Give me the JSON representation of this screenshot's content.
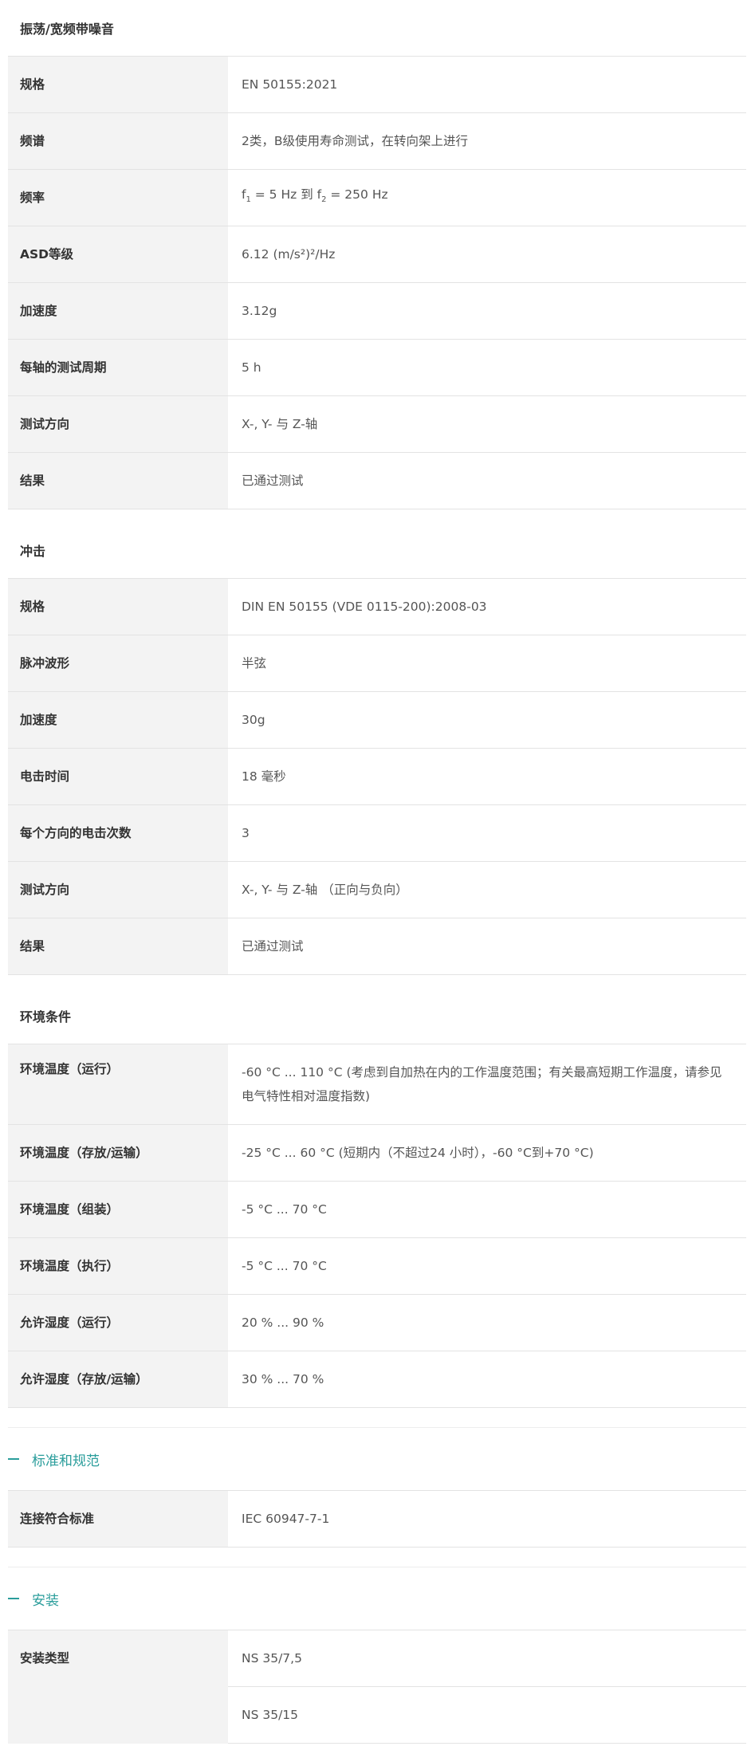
{
  "vibration": {
    "title": "振荡/宽频带噪音",
    "rows": [
      {
        "label": "规格",
        "value": "EN 50155:2021"
      },
      {
        "label": "频谱",
        "value": "2类，B级使用寿命测试，在转向架上进行"
      },
      {
        "label": "频率",
        "f1_prefix": "f",
        "f1_sub": "1",
        "f1_value": " = 5 Hz 到 ",
        "f2_prefix": "f",
        "f2_sub": "2",
        "f2_value": " = 250 Hz"
      },
      {
        "label": "ASD等级",
        "value": "6.12 (m/s²)²/Hz"
      },
      {
        "label": "加速度",
        "value": "3.12g"
      },
      {
        "label": "每轴的测试周期",
        "value": "5 h"
      },
      {
        "label": "测试方向",
        "value": "X-, Y- 与 Z-轴"
      },
      {
        "label": "结果",
        "value": "已通过测试"
      }
    ]
  },
  "shock": {
    "title": "冲击",
    "rows": [
      {
        "label": "规格",
        "value": "DIN EN 50155 (VDE 0115-200):2008-03"
      },
      {
        "label": "脉冲波形",
        "value": "半弦"
      },
      {
        "label": "加速度",
        "value": "30g"
      },
      {
        "label": "电击时间",
        "value": "18 毫秒"
      },
      {
        "label": "每个方向的电击次数",
        "value": "3"
      },
      {
        "label": "测试方向",
        "value": "X-, Y- 与 Z-轴 （正向与负向）"
      },
      {
        "label": "结果",
        "value": "已通过测试"
      }
    ]
  },
  "environment": {
    "title": "环境条件",
    "rows": [
      {
        "label": "环境温度（运行）",
        "value": "-60 °C ... 110 °C (考虑到自加热在内的工作温度范围；有关最高短期工作温度，请参见电气特性相对温度指数)"
      },
      {
        "label": "环境温度（存放/运输）",
        "value": "-25 °C ... 60 °C (短期内（不超过24  小时），-60 °C到+70 °C)"
      },
      {
        "label": "环境温度（组装）",
        "value": "-5 °C ... 70 °C"
      },
      {
        "label": "环境温度（执行）",
        "value": "-5 °C ... 70 °C"
      },
      {
        "label": "允许湿度（运行）",
        "value": "20 % ... 90 %"
      },
      {
        "label": "允许湿度（存放/运输）",
        "value": "30 % ... 70 %"
      }
    ]
  },
  "standards": {
    "title": "标准和规范",
    "rows": [
      {
        "label": "连接符合标准",
        "value": "IEC 60947-7-1"
      }
    ]
  },
  "installation": {
    "title": "安装",
    "rows": [
      {
        "label": "安装类型",
        "value": "NS 35/7,5"
      },
      {
        "label": "",
        "value": "NS 35/15"
      }
    ]
  },
  "colors": {
    "accent": "#2a9d9b",
    "label_bg": "#f3f3f3",
    "border": "#e3e3e3"
  }
}
